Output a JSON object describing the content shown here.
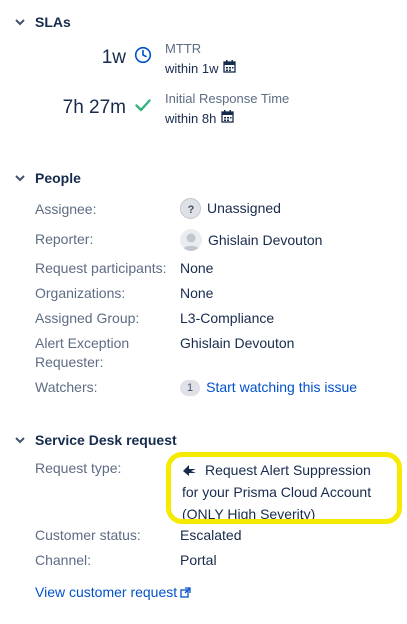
{
  "slas": {
    "title": "SLAs",
    "items": [
      {
        "value": "1w",
        "name": "MTTR",
        "target": "within 1w",
        "status": "clock-icon"
      },
      {
        "value": "7h 27m",
        "name": "Initial Response Time",
        "target": "within 8h",
        "status": "check-icon"
      }
    ]
  },
  "people": {
    "title": "People",
    "assignee_label": "Assignee:",
    "assignee_value": "Unassigned",
    "reporter_label": "Reporter:",
    "reporter_value": "Ghislain Devouton",
    "participants_label": "Request participants:",
    "participants_value": "None",
    "organizations_label": "Organizations:",
    "organizations_value": "None",
    "group_label": "Assigned Group:",
    "group_value": "L3-Compliance",
    "alert_label_line1": "Alert Exception",
    "alert_label_line2": "Requester:",
    "alert_value": "Ghislain Devouton",
    "watchers_label": "Watchers:",
    "watchers_count": "1",
    "watchers_link": "Start watching this issue"
  },
  "service_desk": {
    "title": "Service Desk request",
    "request_type_label": "Request type:",
    "request_type_line1": "Request Alert Suppression",
    "request_type_line2": "for your Prisma Cloud Account",
    "request_type_line3": "(ONLY High Severity)",
    "customer_status_label": "Customer status:",
    "customer_status_value": "Escalated",
    "channel_label": "Channel:",
    "channel_value": "Portal",
    "view_link": "View customer request"
  },
  "colors": {
    "link": "#0052cc",
    "success": "#36b37e",
    "highlight": "#f6ea00"
  }
}
